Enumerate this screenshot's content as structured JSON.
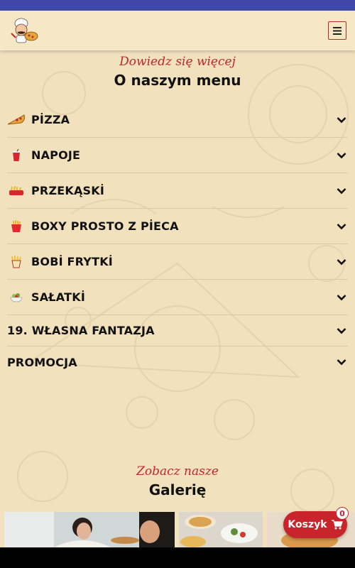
{
  "header": {
    "logo_alt": "pizza chef logo",
    "menu_icon": "hamburger-icon"
  },
  "menu_section": {
    "subtitle": "Dowiedz się więcej",
    "title": "O naszym menu",
    "items": [
      {
        "label": "PİZZA",
        "icon": "pizza-slice-icon"
      },
      {
        "label": "NAPOJE",
        "icon": "drink-cup-icon"
      },
      {
        "label": "PRZEKĄSKİ",
        "icon": "snacks-icon"
      },
      {
        "label": "BOXY PROSTO Z PİECA",
        "icon": "fries-box-icon"
      },
      {
        "label": "BOBİ FRYTKİ",
        "icon": "fries-icon"
      },
      {
        "label": "SAŁATKİ",
        "icon": "salad-bowl-icon"
      },
      {
        "label": "19. WŁASNA FANTAZJA",
        "icon": ""
      },
      {
        "label": "PROMOCJA",
        "icon": ""
      }
    ]
  },
  "gallery_section": {
    "subtitle": "Zobacz nasze",
    "title": "Galerię"
  },
  "cart": {
    "label": "Koszyk",
    "count": "0",
    "icon": "shopping-cart-icon"
  },
  "colors": {
    "accent": "#c9242b",
    "background": "#f1e1bd",
    "topbar": "#3f48a8"
  }
}
